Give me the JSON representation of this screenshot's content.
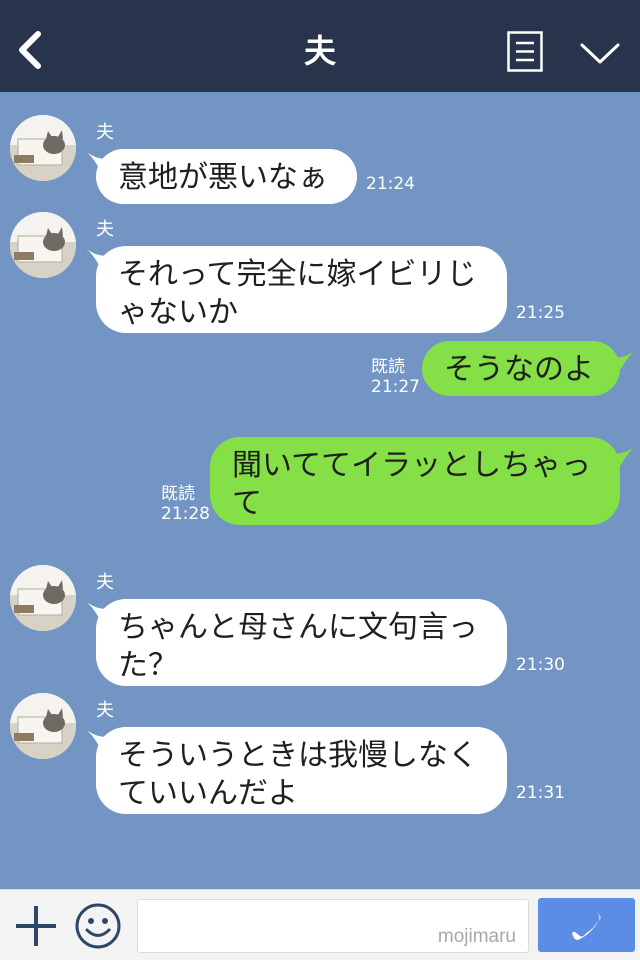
{
  "header": {
    "title": "夫",
    "back_icon": "chevron-left-icon",
    "menu_icon": "list-menu-icon",
    "dropdown_icon": "chevron-down-icon",
    "background": "#28344b"
  },
  "chat": {
    "background": "#7395c3",
    "messages": [
      {
        "direction": "in",
        "sender": "夫",
        "lines": [
          "意地が悪いなぁ"
        ],
        "time": "21:24"
      },
      {
        "direction": "in",
        "sender": "夫",
        "lines": [
          "それって完全に嫁イビリじ",
          "ゃないか"
        ],
        "time": "21:25"
      },
      {
        "direction": "out",
        "lines": [
          "そうなのよ"
        ],
        "read": "既読",
        "time": "21:27"
      },
      {
        "direction": "out",
        "lines": [
          "聞いててイラッとしちゃっ",
          "て"
        ],
        "read": "既読",
        "time": "21:28"
      },
      {
        "direction": "in",
        "sender": "夫",
        "lines": [
          "ちゃんと母さんに文句言っ",
          "た？"
        ],
        "time": "21:30"
      },
      {
        "direction": "in",
        "sender": "夫",
        "lines": [
          "そういうときは我慢しなく",
          "ていいんだよ"
        ],
        "time": "21:31"
      }
    ],
    "incoming_bubble_color": "#ffffff",
    "outgoing_bubble_color": "#85e048"
  },
  "footer": {
    "plus_icon": "plus-icon",
    "emoji_icon": "smiley-icon",
    "input_value": "",
    "watermark": "mojimaru",
    "call_icon": "phone-icon",
    "call_button_color": "#5c8de6"
  }
}
